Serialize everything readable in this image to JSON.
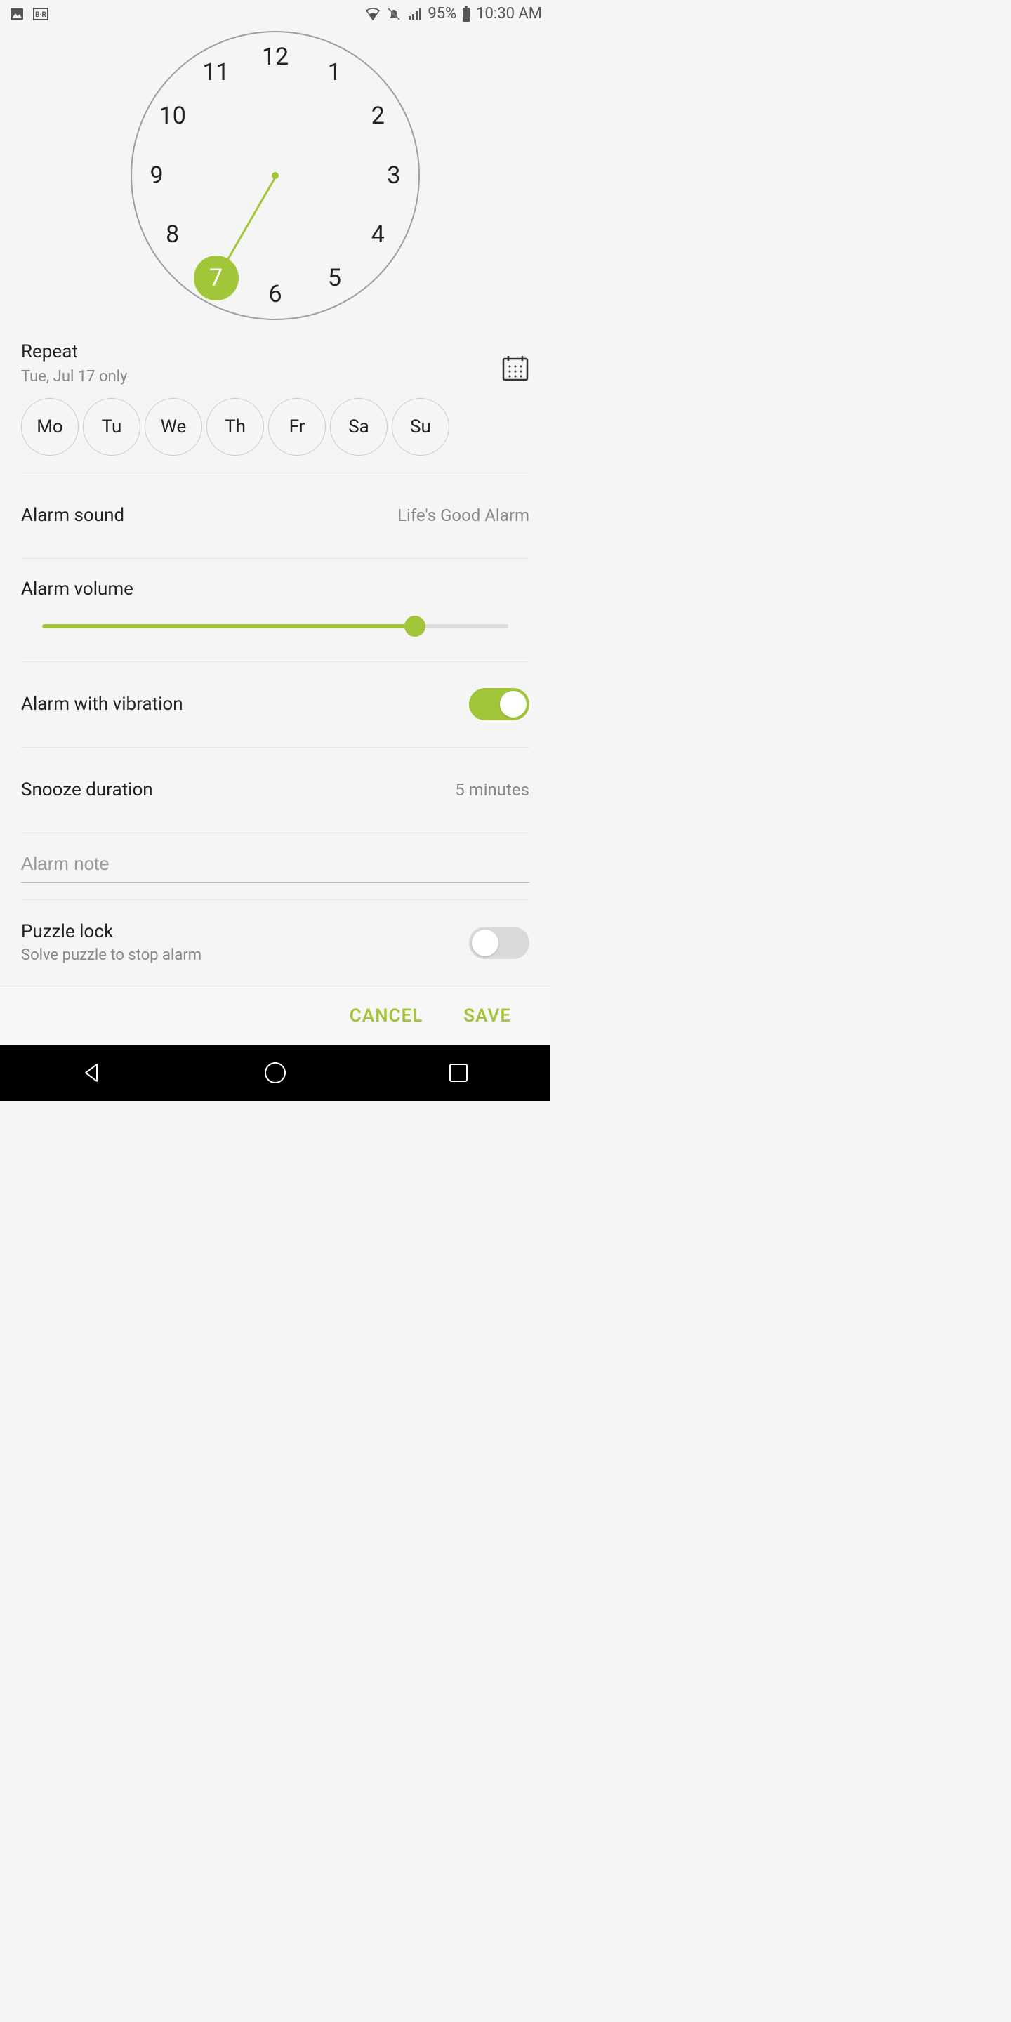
{
  "status": {
    "battery": "95%",
    "time": "10:30 AM"
  },
  "clock": {
    "numbers": [
      "12",
      "1",
      "2",
      "3",
      "4",
      "5",
      "6",
      "7",
      "8",
      "9",
      "10",
      "11"
    ],
    "selected": "7"
  },
  "repeat": {
    "title": "Repeat",
    "subtitle": "Tue, Jul 17 only",
    "days": [
      "Mo",
      "Tu",
      "We",
      "Th",
      "Fr",
      "Sa",
      "Su"
    ]
  },
  "sound": {
    "label": "Alarm sound",
    "value": "Life's Good Alarm"
  },
  "volume": {
    "label": "Alarm volume",
    "percent": 80
  },
  "vibration": {
    "label": "Alarm with vibration",
    "on": true
  },
  "snooze": {
    "label": "Snooze duration",
    "value": "5 minutes"
  },
  "note": {
    "placeholder": "Alarm note"
  },
  "puzzle": {
    "label": "Puzzle lock",
    "subtitle": "Solve puzzle to stop alarm",
    "on": false
  },
  "actions": {
    "cancel": "CANCEL",
    "save": "SAVE"
  }
}
